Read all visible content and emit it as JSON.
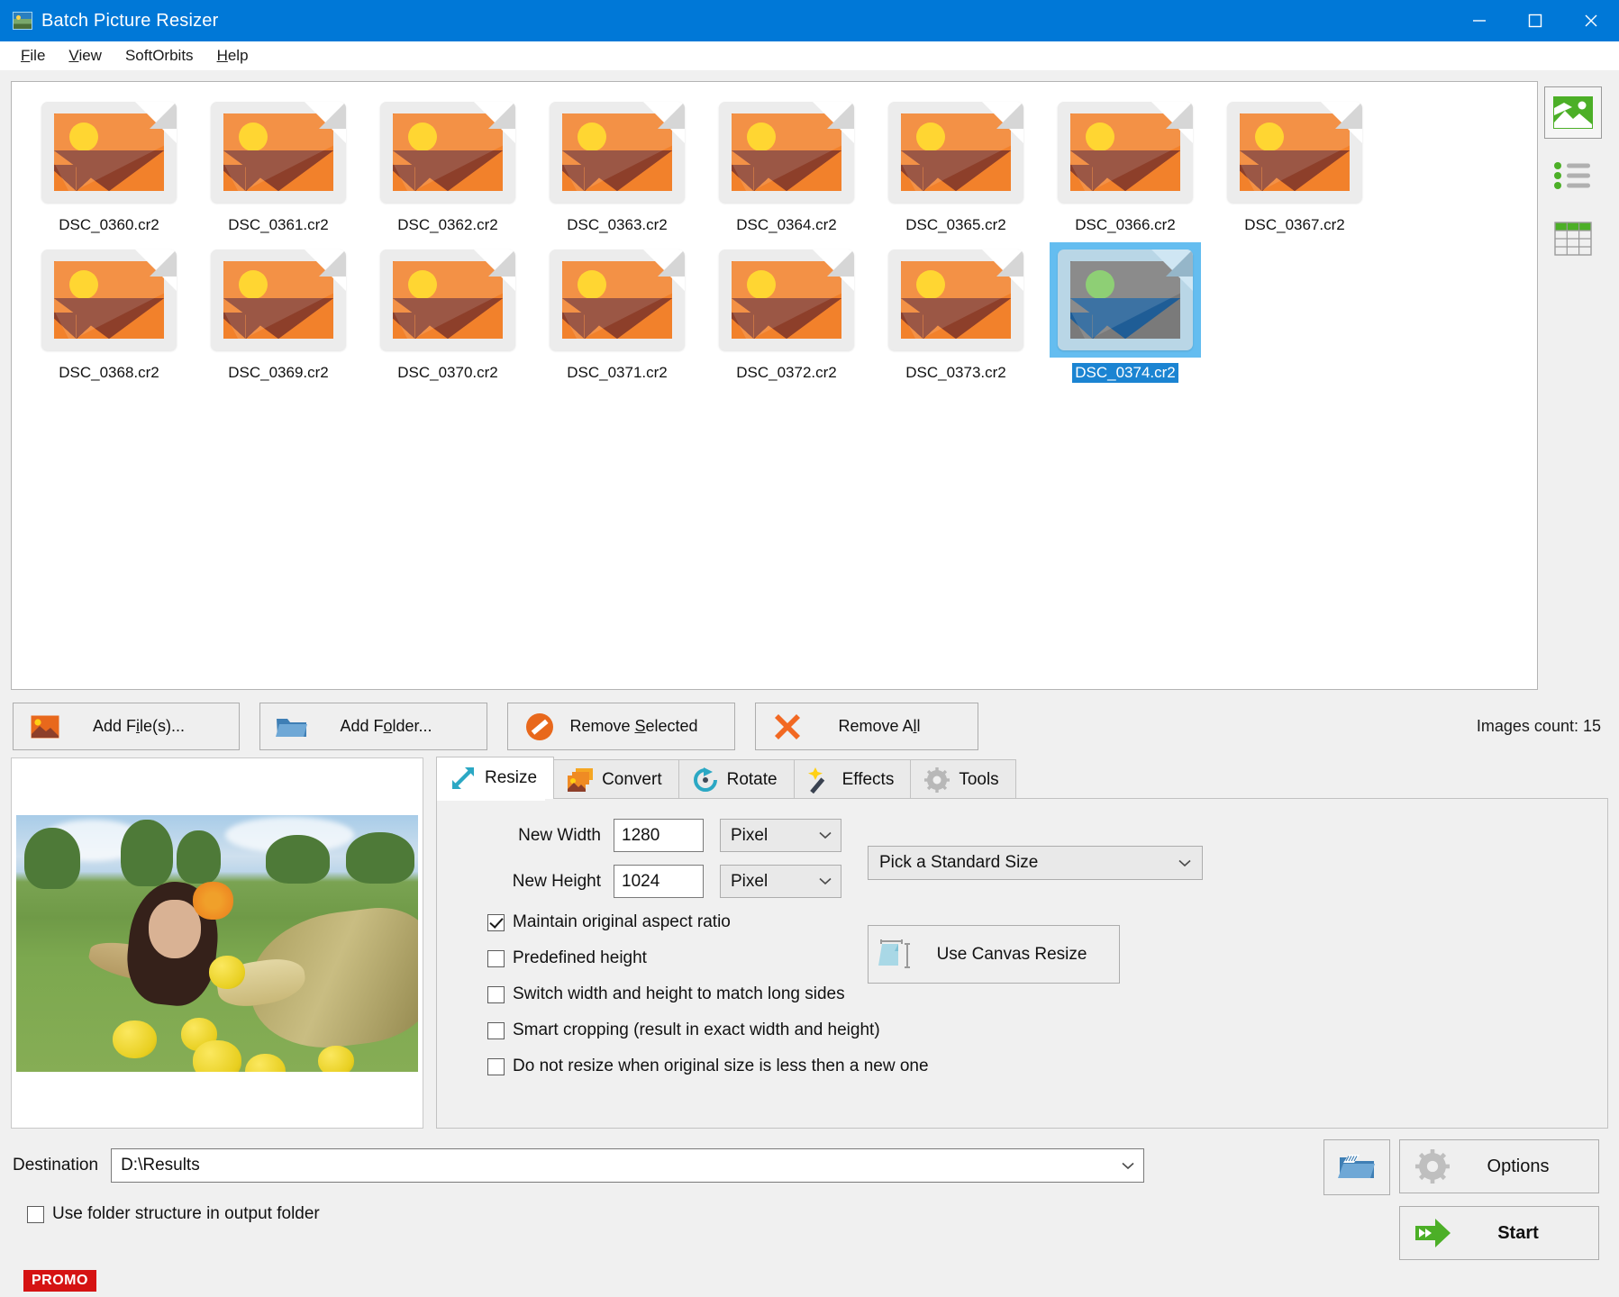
{
  "window": {
    "title": "Batch Picture Resizer",
    "app_icon": "app-photo-icon",
    "minimize": "minimize-icon",
    "maximize": "maximize-icon",
    "close": "close-icon"
  },
  "menu": {
    "items": [
      {
        "label": "File",
        "accel": "F"
      },
      {
        "label": "View",
        "accel": "V"
      },
      {
        "label": "SoftOrbits",
        "accel": ""
      },
      {
        "label": "Help",
        "accel": "H"
      }
    ]
  },
  "thumbnails": {
    "items": [
      {
        "name": "DSC_0360.cr2",
        "selected": false
      },
      {
        "name": "DSC_0361.cr2",
        "selected": false
      },
      {
        "name": "DSC_0362.cr2",
        "selected": false
      },
      {
        "name": "DSC_0363.cr2",
        "selected": false
      },
      {
        "name": "DSC_0364.cr2",
        "selected": false
      },
      {
        "name": "DSC_0365.cr2",
        "selected": false
      },
      {
        "name": "DSC_0366.cr2",
        "selected": false
      },
      {
        "name": "DSC_0367.cr2",
        "selected": false
      },
      {
        "name": "DSC_0368.cr2",
        "selected": false
      },
      {
        "name": "DSC_0369.cr2",
        "selected": false
      },
      {
        "name": "DSC_0370.cr2",
        "selected": false
      },
      {
        "name": "DSC_0371.cr2",
        "selected": false
      },
      {
        "name": "DSC_0372.cr2",
        "selected": false
      },
      {
        "name": "DSC_0373.cr2",
        "selected": false
      },
      {
        "name": "DSC_0374.cr2",
        "selected": true
      }
    ]
  },
  "view_modes": [
    {
      "icon": "thumbnail-view-icon",
      "active": true
    },
    {
      "icon": "list-view-icon",
      "active": false
    },
    {
      "icon": "table-view-icon",
      "active": false
    }
  ],
  "actions": {
    "add_files": "Add File(s)...",
    "add_folder": "Add Folder...",
    "remove_selected": "Remove Selected",
    "remove_all": "Remove All",
    "images_count": "Images count: 15"
  },
  "tabs": [
    {
      "label": "Resize",
      "icon": "resize-arrows-icon",
      "active": true
    },
    {
      "label": "Convert",
      "icon": "convert-images-icon",
      "active": false
    },
    {
      "label": "Rotate",
      "icon": "rotate-circular-arrow-icon",
      "active": false
    },
    {
      "label": "Effects",
      "icon": "magic-wand-icon",
      "active": false
    },
    {
      "label": "Tools",
      "icon": "gear-tools-icon",
      "active": false
    }
  ],
  "resize": {
    "new_width_label": "New Width",
    "new_width_value": "1280",
    "new_width_unit": "Pixel",
    "new_height_label": "New Height",
    "new_height_value": "1024",
    "new_height_unit": "Pixel",
    "standard_size": "Pick a Standard Size",
    "canvas_resize": "Use Canvas Resize",
    "checkboxes": [
      {
        "label": "Maintain original aspect ratio",
        "checked": true
      },
      {
        "label": "Predefined height",
        "checked": false
      },
      {
        "label": "Switch width and height to match long sides",
        "checked": false
      },
      {
        "label": "Smart cropping (result in exact width and height)",
        "checked": false
      },
      {
        "label": "Do not resize when original size is less then a new one",
        "checked": false
      }
    ]
  },
  "bottom": {
    "destination_label": "Destination",
    "destination_value": "D:\\Results",
    "folder_structure_label": "Use folder structure in output folder",
    "folder_structure_checked": false,
    "browse_icon": "browse-folder-icon",
    "options": "Options",
    "start": "Start",
    "promo": "PROMO"
  },
  "colors": {
    "titlebar": "#0078d7",
    "selection": "#64bdf0",
    "selection_label": "#1b84d2",
    "accent_green": "#4caf27",
    "accent_orange": "#f2812b",
    "promo_red": "#d51313",
    "teal": "#2ba8c4"
  }
}
